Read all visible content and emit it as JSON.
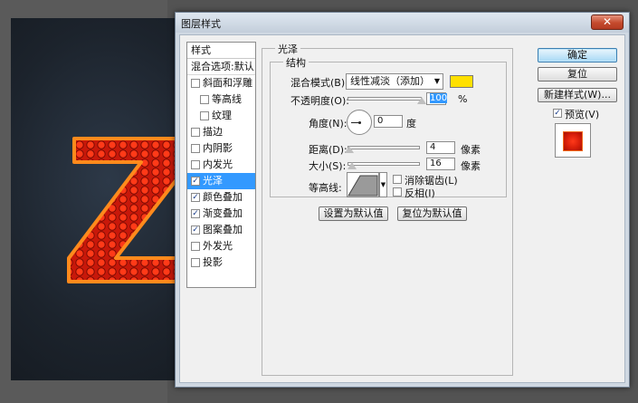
{
  "dialog": {
    "title": "图层样式",
    "close_label": "✕"
  },
  "style_list": {
    "header": "样式",
    "blend_options": "混合选项:默认",
    "items": [
      {
        "label": "斜面和浮雕",
        "checked": false,
        "indent": false
      },
      {
        "label": "等高线",
        "checked": false,
        "indent": true
      },
      {
        "label": "纹理",
        "checked": false,
        "indent": true
      },
      {
        "label": "描边",
        "checked": false,
        "indent": false
      },
      {
        "label": "内阴影",
        "checked": false,
        "indent": false
      },
      {
        "label": "内发光",
        "checked": false,
        "indent": false
      },
      {
        "label": "光泽",
        "checked": true,
        "indent": false,
        "selected": true
      },
      {
        "label": "颜色叠加",
        "checked": true,
        "indent": false
      },
      {
        "label": "渐变叠加",
        "checked": true,
        "indent": false
      },
      {
        "label": "图案叠加",
        "checked": true,
        "indent": false
      },
      {
        "label": "外发光",
        "checked": false,
        "indent": false
      },
      {
        "label": "投影",
        "checked": false,
        "indent": false
      }
    ]
  },
  "satin": {
    "group_title": "光泽",
    "structure_title": "结构",
    "blend_mode_label": "混合模式(B):",
    "blend_mode_value": "线性减淡（添加）",
    "blend_color": "#ffe000",
    "opacity_label": "不透明度(O):",
    "opacity_value": "100",
    "opacity_unit": "%",
    "opacity_level": 1.0,
    "angle_label": "角度(N):",
    "angle_value": "0",
    "angle_unit": "度",
    "distance_label": "距离(D):",
    "distance_value": "4",
    "distance_unit": "像素",
    "distance_level": 0.02,
    "size_label": "大小(S):",
    "size_value": "16",
    "size_unit": "像素",
    "size_level": 0.06,
    "contour_label": "等高线:",
    "antialias_label": "消除锯齿(L)",
    "invert_label": "反相(I)",
    "set_default_label": "设置为默认值",
    "reset_default_label": "复位为默认值"
  },
  "side": {
    "ok_label": "确定",
    "reset_label": "复位",
    "new_style_label": "新建样式(W)...",
    "preview_label": "预览(V)",
    "preview_checked": true
  },
  "colors": {
    "selection": "#3399ff",
    "letter": "#e0240d",
    "letter_edge": "#ff8a1c"
  }
}
